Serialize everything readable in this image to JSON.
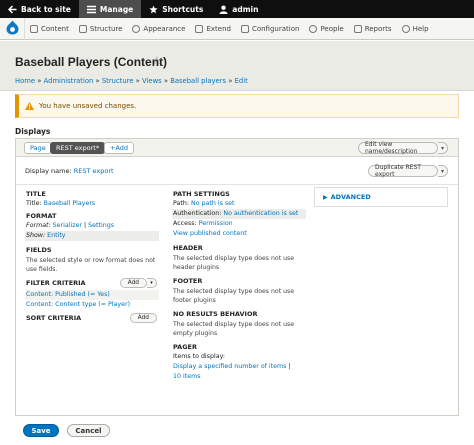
{
  "toolbar": {
    "back": "Back to site",
    "manage": "Manage",
    "shortcuts": "Shortcuts",
    "user": "admin"
  },
  "tray": {
    "items": [
      "Content",
      "Structure",
      "Appearance",
      "Extend",
      "Configuration",
      "People",
      "Reports",
      "Help"
    ]
  },
  "page": {
    "title": "Baseball Players (Content)",
    "breadcrumb": [
      "Home",
      "Administration",
      "Structure",
      "Views",
      "Baseball players",
      "Edit"
    ],
    "breadcrumb_sep": "»"
  },
  "warning": {
    "text": "You have unsaved changes."
  },
  "displays": {
    "label": "Displays",
    "tabs": [
      "Page",
      "REST export*"
    ],
    "add_label": "+Add",
    "edit_view_name": "Edit view name/description",
    "display_name_label": "Display name:",
    "display_name_value": "REST export",
    "duplicate_label": "Duplicate REST export",
    "advanced_label": "ADVANCED"
  },
  "first": {
    "title_heading": "TITLE",
    "title_label": "Title:",
    "title_value": "Baseball Players",
    "format_heading": "FORMAT",
    "format_label": "Format:",
    "format_value": "Serializer",
    "format_sep": "|",
    "settings_label": "Settings",
    "show_label": "Show:",
    "show_value": "Entity",
    "fields_heading": "FIELDS",
    "fields_note": "The selected style or row format does not use fields.",
    "filter_heading": "FILTER CRITERIA",
    "filter_add": "Add",
    "filters": [
      "Content: Published (= Yes)",
      "Content: Content type (= Player)"
    ],
    "sort_heading": "SORT CRITERIA",
    "sort_add": "Add"
  },
  "second": {
    "path_heading": "PATH SETTINGS",
    "path_label": "Path:",
    "path_value": "No path is set",
    "auth_label": "Authentication:",
    "auth_value": "No authentication is set",
    "access_label": "Access:",
    "access_value": "Permission",
    "view_published": "View published content",
    "header_heading": "HEADER",
    "header_note": "The selected display type does not use header plugins",
    "footer_heading": "FOOTER",
    "footer_note": "The selected display type does not use footer plugins",
    "noresults_heading": "NO RESULTS BEHAVIOR",
    "noresults_note": "The selected display type does not use empty plugins",
    "pager_heading": "PAGER",
    "items_label": "Items to display:",
    "pager_value": "Display a specified number of items",
    "pager_sep": "|",
    "items_value": "10 items"
  },
  "actions": {
    "save": "Save",
    "cancel": "Cancel"
  },
  "colors": {
    "link": "#0074bd",
    "warning_border": "#e09600",
    "toolbar": "#0f0f0f"
  }
}
